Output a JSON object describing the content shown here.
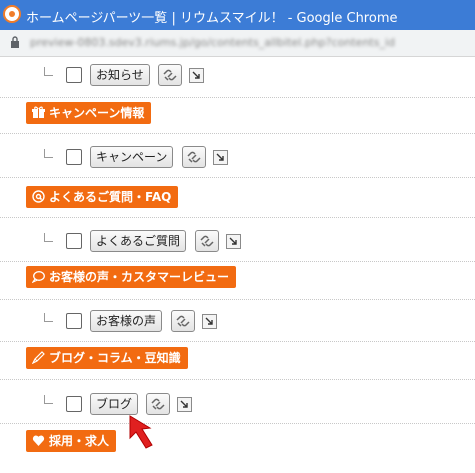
{
  "window": {
    "title": "ホームページパーツ一覧 | リウムスマイル！ - Google Chrome",
    "url": "preview-0803.sdev3.riums.jp/go/contents_allbitel.php?contents_id"
  },
  "categories": [
    {
      "label": "キャンペーン情報",
      "icon": "gift-icon"
    },
    {
      "label": "よくあるご質問・FAQ",
      "icon": "question-icon"
    },
    {
      "label": "お客様の声・カスタマーレビュー",
      "icon": "speech-bubble-icon"
    },
    {
      "label": "ブログ・コラム・豆知識",
      "icon": "pen-icon"
    },
    {
      "label": "採用・求人",
      "icon": "heart-icon"
    }
  ],
  "items": [
    {
      "label": "お知らせ"
    },
    {
      "label": "キャンペーン"
    },
    {
      "label": "よくあるご質問"
    },
    {
      "label": "お客様の声"
    },
    {
      "label": "ブログ"
    }
  ],
  "colors": {
    "accent": "#f26b11",
    "titlebar": "#3c7cd6",
    "cursor": "#e02020"
  }
}
